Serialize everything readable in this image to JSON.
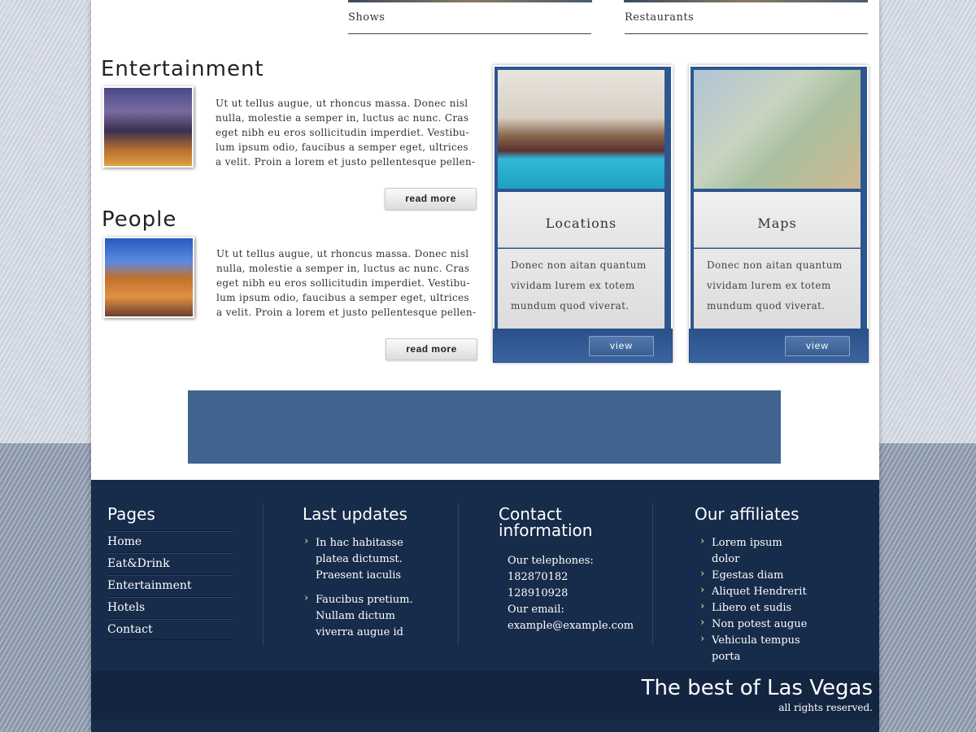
{
  "top_links": [
    "Shows",
    "Restaurants"
  ],
  "sections": [
    {
      "title": "Entertainment",
      "text": "Ut ut tellus augue, ut rhoncus massa. Donec nisl nulla, molestie a semper in, luctus ac nunc. Cras eget nibh eu eros sollicitudin imperdiet. Vestibu-lum ipsum odio, faucibus a semper eget, ultrices a velit. Proin a lorem et justo pellentesque pellen-",
      "button": "read more"
    },
    {
      "title": "People",
      "text": "Ut ut tellus augue, ut rhoncus massa. Donec nisl nulla, molestie a semper in, luctus ac nunc. Cras eget nibh eu eros sollicitudin imperdiet. Vestibu-lum ipsum odio, faucibus a semper eget, ultrices a velit. Proin a lorem et justo pellentesque pellen-",
      "button": "read more"
    }
  ],
  "cards": [
    {
      "title": "Locations",
      "text": "Donec non aitan quantum vividam lurem ex totem mundum quod viverat.",
      "button": "view"
    },
    {
      "title": "Maps",
      "text": "Donec non aitan quantum vividam lurem ex totem mundum quod viverat.",
      "button": "view"
    }
  ],
  "footer": {
    "pages": {
      "title": "Pages",
      "links": [
        "Home",
        "Eat&Drink",
        "Entertainment",
        "Hotels",
        "Contact"
      ]
    },
    "updates": {
      "title": "Last updates",
      "items": [
        "In hac habitasse platea dictumst. Praesent iaculis",
        "Faucibus pretium. Nullam dictum viverra augue id"
      ]
    },
    "contact": {
      "title": "Contact information",
      "tel_label": "Our telephones:",
      "tel1": "182870182",
      "tel2": "128910928",
      "email_label": "Our email:",
      "email": "example@example.com"
    },
    "affiliates": {
      "title": "Our affiliates",
      "items": [
        "Lorem ipsum dolor",
        "Egestas diam",
        "Aliquet Hendrerit",
        "Libero et sudis",
        "Non potest augue",
        "Vehicula tempus porta"
      ]
    },
    "tagline": "The best of Las Vegas",
    "rights": "all rights reserved."
  },
  "colors": {
    "accent": "#2d5690",
    "banner": "#41638f",
    "footer": "#172b4a"
  }
}
